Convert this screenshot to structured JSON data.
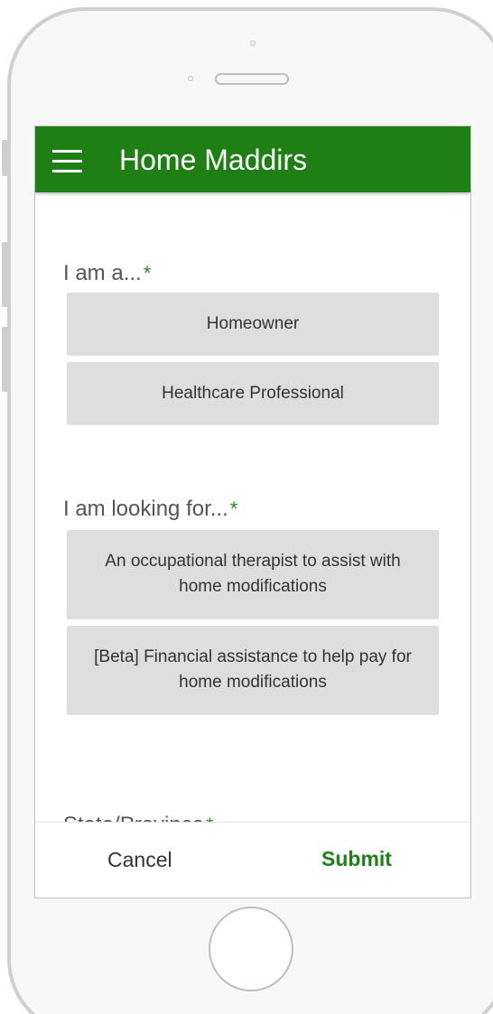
{
  "app_bar": {
    "title": "Home Maddirs",
    "color": "#1e7f15"
  },
  "icons": {
    "menu": "hamburger-menu-icon"
  },
  "form": {
    "role_question": {
      "label": "I am a...",
      "required_mark": "*",
      "options": [
        "Homeowner",
        "Healthcare Professional"
      ]
    },
    "looking_for_question": {
      "label": "I am looking for...",
      "required_mark": "*",
      "options": [
        "An occupational therapist to assist with home modifications",
        "[Beta] Financial assistance to help pay for home modifications"
      ]
    },
    "state_question": {
      "label": "State/Province",
      "required_mark": "*"
    }
  },
  "actions": {
    "cancel_label": "Cancel",
    "submit_label": "Submit"
  },
  "colors": {
    "accent": "#1e7f15",
    "option_background": "#dedede"
  }
}
